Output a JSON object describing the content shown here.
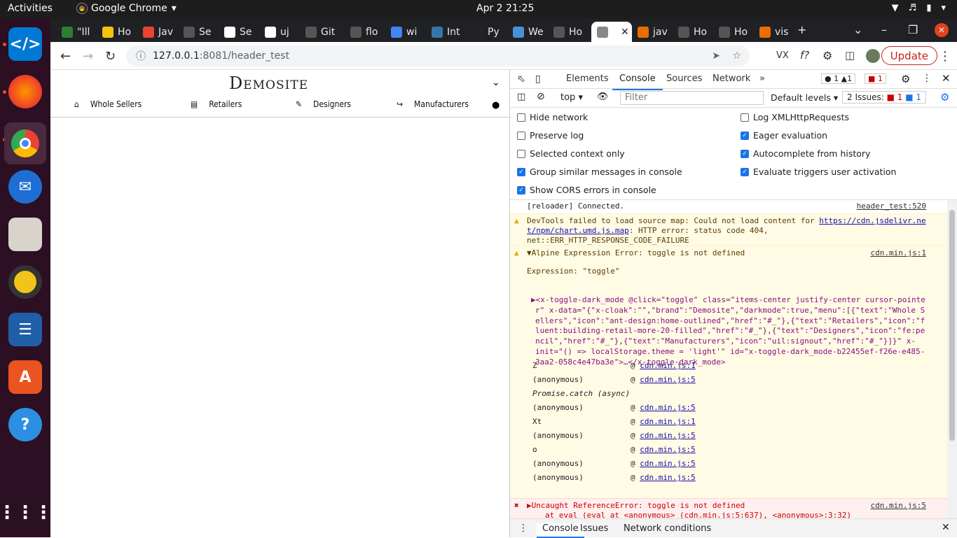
{
  "system": {
    "activities": "Activities",
    "app_name": "Google Chrome",
    "clock": "Apr 2  21:25"
  },
  "tabs": [
    {
      "label": "\"Ill",
      "color": "#2e7d32"
    },
    {
      "label": "Ho",
      "color": "#f4c20d"
    },
    {
      "label": "Jav",
      "color": "#ea4335"
    },
    {
      "label": "Se",
      "color": "#555555"
    },
    {
      "label": "Se",
      "color": "#ffffff"
    },
    {
      "label": "uj",
      "color": "#ffffff"
    },
    {
      "label": "Git",
      "color": "#555555"
    },
    {
      "label": "flo",
      "color": "#555555"
    },
    {
      "label": "wi",
      "color": "#4285f4"
    },
    {
      "label": "Int",
      "color": "#3776ab"
    },
    {
      "label": "Py",
      "color": "#222222"
    },
    {
      "label": "We",
      "color": "#4a90d9"
    },
    {
      "label": "Ho",
      "color": "#555555"
    },
    {
      "label": "",
      "color": "#888888",
      "active": true
    },
    {
      "label": "jav",
      "color": "#e76f00"
    },
    {
      "label": "Ho",
      "color": "#555555"
    },
    {
      "label": "Ho",
      "color": "#555555"
    },
    {
      "label": "vis",
      "color": "#e76f00"
    }
  ],
  "omnibox": {
    "host": "127.0.0.1",
    "rest": ":8081/header_test"
  },
  "toolbar": {
    "update_label": "Update"
  },
  "page": {
    "brand": "Demosite",
    "nav": [
      {
        "label": "Whole Sellers",
        "icon": "home-icon"
      },
      {
        "label": "Retailers",
        "icon": "store-icon"
      },
      {
        "label": "Designers",
        "icon": "pencil-icon"
      },
      {
        "label": "Manufacturers",
        "icon": "signout-icon"
      }
    ]
  },
  "devtools": {
    "tabs": [
      "Elements",
      "Console",
      "Sources",
      "Network"
    ],
    "selected_tab": "Console",
    "badges": {
      "errors": "1",
      "warnings": "1",
      "issues_count": "1"
    },
    "context": "top",
    "filter_placeholder": "Filter",
    "levels": "Default levels",
    "issues": {
      "label": "2 Issues:",
      "err": "1",
      "info": "1"
    },
    "settings_left": [
      {
        "label": "Hide network",
        "checked": false
      },
      {
        "label": "Preserve log",
        "checked": false
      },
      {
        "label": "Selected context only",
        "checked": false
      },
      {
        "label": "Group similar messages in console",
        "checked": true
      },
      {
        "label": "Show CORS errors in console",
        "checked": true
      }
    ],
    "settings_right": [
      {
        "label": "Log XMLHttpRequests",
        "checked": false
      },
      {
        "label": "Eager evaluation",
        "checked": true
      },
      {
        "label": "Autocomplete from history",
        "checked": true
      },
      {
        "label": "Evaluate triggers user activation",
        "checked": true
      }
    ],
    "console": {
      "reloader": {
        "text": "[reloader] Connected.",
        "src": "header_test:520"
      },
      "sourcemap": {
        "line1": "DevTools failed to load source map: Could not load content for ",
        "link1": "https://cdn.jsdelivr.ne",
        "link2": "t/npm/chart.umd.js.map",
        "line2": ": HTTP error: status code 404,",
        "line3": "net::ERR_HTTP_RESPONSE_CODE_FAILURE"
      },
      "alpine": {
        "text": "▼Alpine Expression Error: toggle is not defined",
        "src": "cdn.min.js:1",
        "expression": "Expression: \"toggle\"",
        "element_lines": [
          "▶<x-toggle-dark_mode @click=\"toggle\" class=\"items-center justify-center cursor-pointe",
          "r\" x-data=\"{\"x-cloak\":\"\",\"brand\":\"Demosite\",\"darkmode\":true,\"menu\":[{\"text\":\"Whole S",
          "ellers\",\"icon\":\"ant-design:home-outlined\",\"href\":\"#_\"},{\"text\":\"Retailers\",\"icon\":\"f",
          "luent:building-retail-more-20-filled\",\"href\":\"#_\"},{\"text\":\"Designers\",\"icon\":\"fe:pe",
          "ncil\",\"href\":\"#_\"},{\"text\":\"Manufacturers\",\"icon\":\"uil:signout\",\"href\":\"#_\"}]}\" x-",
          "init=\"() => localStorage.theme = 'light'\" id=\"x-toggle-dark_mode-b22455ef-f26e-e485-",
          "3aa2-058c4e47ba3e\">…</x-toggle-dark_mode>"
        ],
        "stack": [
          {
            "fn": "Z",
            "src": "cdn.min.js:1"
          },
          {
            "fn": "(anonymous)",
            "src": "cdn.min.js:5"
          },
          {
            "fn": "Promise.catch (async)",
            "src": ""
          },
          {
            "fn": "(anonymous)",
            "src": "cdn.min.js:5"
          },
          {
            "fn": "Xt",
            "src": "cdn.min.js:1"
          },
          {
            "fn": "(anonymous)",
            "src": "cdn.min.js:5"
          },
          {
            "fn": "o",
            "src": "cdn.min.js:5"
          },
          {
            "fn": "(anonymous)",
            "src": "cdn.min.js:5"
          },
          {
            "fn": "(anonymous)",
            "src": "cdn.min.js:5"
          }
        ]
      },
      "uncaught": {
        "text": "▶Uncaught ReferenceError: toggle is not defined",
        "src": "cdn.min.js:5",
        "line2": "at eval (eval at <anonymous> (cdn.min.js:5:637), <anonymous>:3:32)"
      }
    },
    "drawer_tabs": [
      "Console",
      "Issues",
      "Network conditions"
    ]
  }
}
